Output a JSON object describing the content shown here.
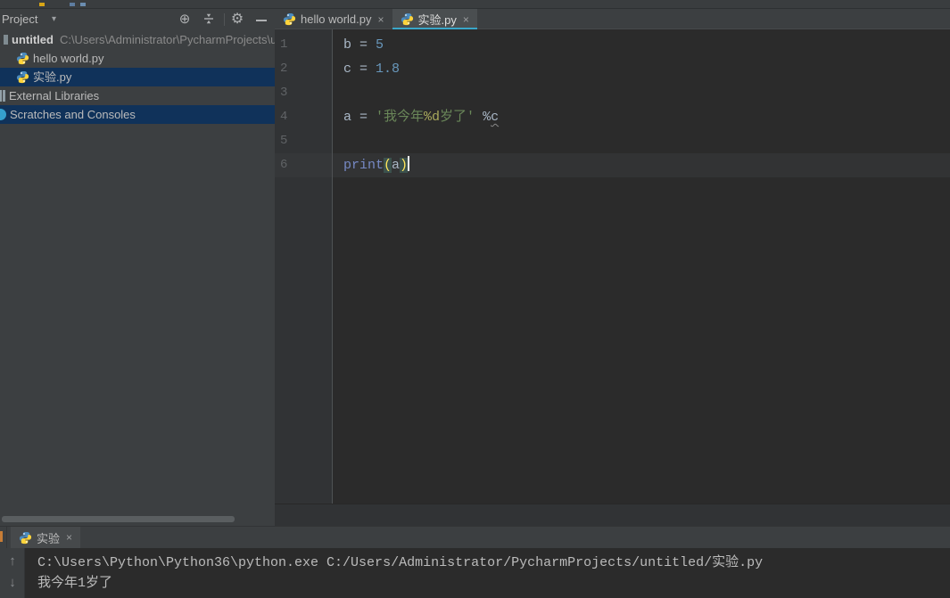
{
  "project_panel": {
    "title": "Project",
    "toolbar": {
      "locate_icon": "⊕",
      "settings_icon": "⚙",
      "caret_icon": "▾"
    },
    "tree": [
      {
        "name": "untitled",
        "path_suffix": "C:\\Users\\Administrator\\PycharmProjects\\u",
        "icon": "folder-icon",
        "bold": true,
        "selected": false,
        "indent": 4
      },
      {
        "name": "hello world.py",
        "icon": "python-icon",
        "bold": false,
        "selected": false,
        "indent": 17
      },
      {
        "name": "实验.py",
        "icon": "python-icon",
        "bold": false,
        "selected": true,
        "indent": 17
      },
      {
        "name": "External Libraries",
        "icon": "libraries-icon",
        "bold": false,
        "selected": false,
        "indent": 0
      },
      {
        "name": "Scratches and Consoles",
        "icon": "scratches-icon",
        "bold": false,
        "selected": true,
        "indent": 0
      }
    ]
  },
  "editor": {
    "tabs": [
      {
        "label": "hello world.py",
        "icon": "python-icon",
        "close": "×",
        "active": false
      },
      {
        "label": "实验.py",
        "icon": "python-icon",
        "close": "×",
        "active": true
      }
    ],
    "code_lines": [
      {
        "num": "1",
        "current": false,
        "cursor": false,
        "tokens": [
          {
            "text": "b = ",
            "style": "plain"
          },
          {
            "text": "5",
            "style": "number"
          }
        ]
      },
      {
        "num": "2",
        "current": false,
        "cursor": false,
        "tokens": [
          {
            "text": "c = ",
            "style": "plain"
          },
          {
            "text": "1.8",
            "style": "number"
          }
        ]
      },
      {
        "num": "3",
        "current": false,
        "cursor": false,
        "tokens": []
      },
      {
        "num": "4",
        "current": false,
        "cursor": false,
        "tokens": [
          {
            "text": "a = ",
            "style": "plain"
          },
          {
            "text": "'我今年",
            "style": "string"
          },
          {
            "text": "%d",
            "style": "format"
          },
          {
            "text": "岁了'",
            "style": "string"
          },
          {
            "text": " %",
            "style": "plain"
          },
          {
            "text": "c",
            "style": "plain warn"
          }
        ]
      },
      {
        "num": "5",
        "current": false,
        "cursor": false,
        "tokens": []
      },
      {
        "num": "6",
        "current": true,
        "cursor": true,
        "tokens": [
          {
            "text": "print",
            "style": "builtin"
          },
          {
            "text": "(",
            "style": "paren"
          },
          {
            "text": "a",
            "style": "plain"
          },
          {
            "text": ")",
            "style": "paren"
          }
        ]
      }
    ]
  },
  "run_panel": {
    "tab": {
      "label": "实验",
      "icon": "python-icon",
      "close": "×"
    },
    "gutter_icons": {
      "up": "↑",
      "down": "↓"
    },
    "output_lines": [
      "C:\\Users\\Python\\Python36\\python.exe C:/Users/Administrator/PycharmProjects/untitled/实验.py",
      "我今年1岁了"
    ]
  },
  "colors": {
    "panel_bg": "#3C3F41",
    "editor_bg": "#2B2B2B",
    "selection_bg": "#10325A",
    "active_tab_underline": "#39A6C9",
    "string_green": "#6A8759",
    "number_blue": "#6897BB",
    "builtin_blue": "#7689C4",
    "paren_yellow": "#FFE65B",
    "paren_match_bg": "#3B514D"
  }
}
